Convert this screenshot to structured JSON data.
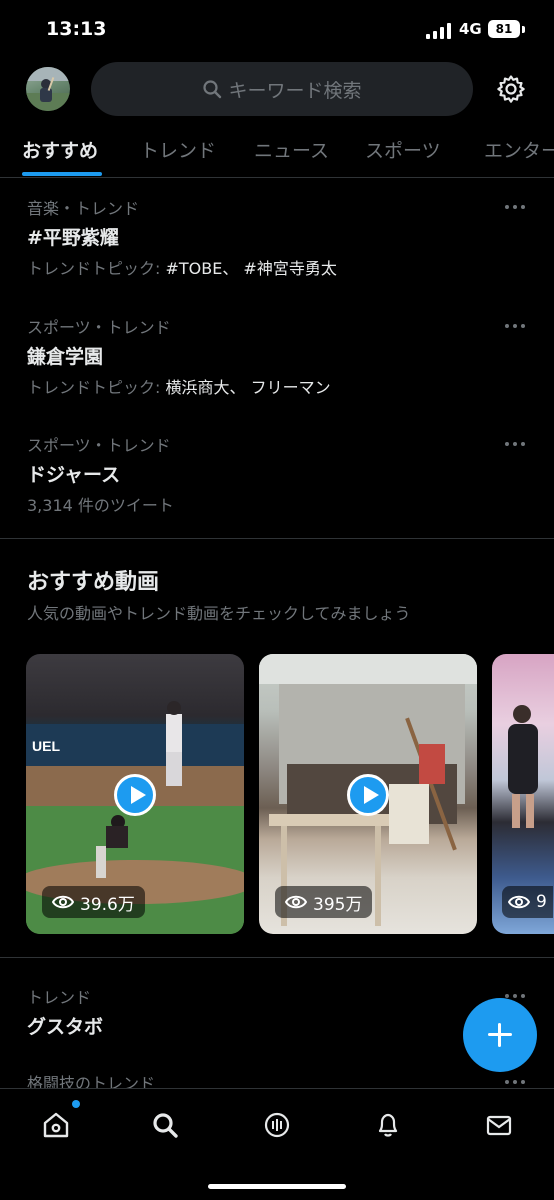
{
  "status_bar": {
    "time": "13:13",
    "network": "4G",
    "battery": "81"
  },
  "header": {
    "search_placeholder": "キーワード検索"
  },
  "tabs": [
    {
      "label": "おすすめ",
      "active": true
    },
    {
      "label": "トレンド",
      "active": false
    },
    {
      "label": "ニュース",
      "active": false
    },
    {
      "label": "スポーツ",
      "active": false
    },
    {
      "label": "エンター",
      "active": false
    }
  ],
  "trends": [
    {
      "category": "音楽・トレンド",
      "name": "#平野紫耀",
      "meta_prefix": "トレンドトピック: ",
      "meta_value": "#TOBE、 #神宮寺勇太"
    },
    {
      "category": "スポーツ・トレンド",
      "name": "鎌倉学園",
      "meta_prefix": "トレンドトピック: ",
      "meta_value": "横浜商大、 フリーマン"
    },
    {
      "category": "スポーツ・トレンド",
      "name": "ドジャース",
      "meta_prefix": "3,314 件のツイート",
      "meta_value": ""
    }
  ],
  "videos_section": {
    "title": "おすすめ動画",
    "subtitle": "人気の動画やトレンド動画をチェックしてみましょう",
    "cards": [
      {
        "views": "39.6万"
      },
      {
        "views": "395万"
      },
      {
        "views": "9"
      }
    ]
  },
  "lower_trends": [
    {
      "category": "トレンド",
      "name": "グスタボ"
    },
    {
      "category": "格闘技のトレンド",
      "name": ""
    }
  ],
  "colors": {
    "accent": "#1d9bf0",
    "background": "#000000",
    "muted": "#71767b",
    "text": "#e7e9ea"
  },
  "icons": {
    "nav": [
      "home-icon",
      "search-icon",
      "spaces-icon",
      "notifications-icon",
      "messages-icon"
    ],
    "header": [
      "avatar",
      "search-icon",
      "settings-gear-icon"
    ],
    "fab": "compose-plus-icon"
  }
}
